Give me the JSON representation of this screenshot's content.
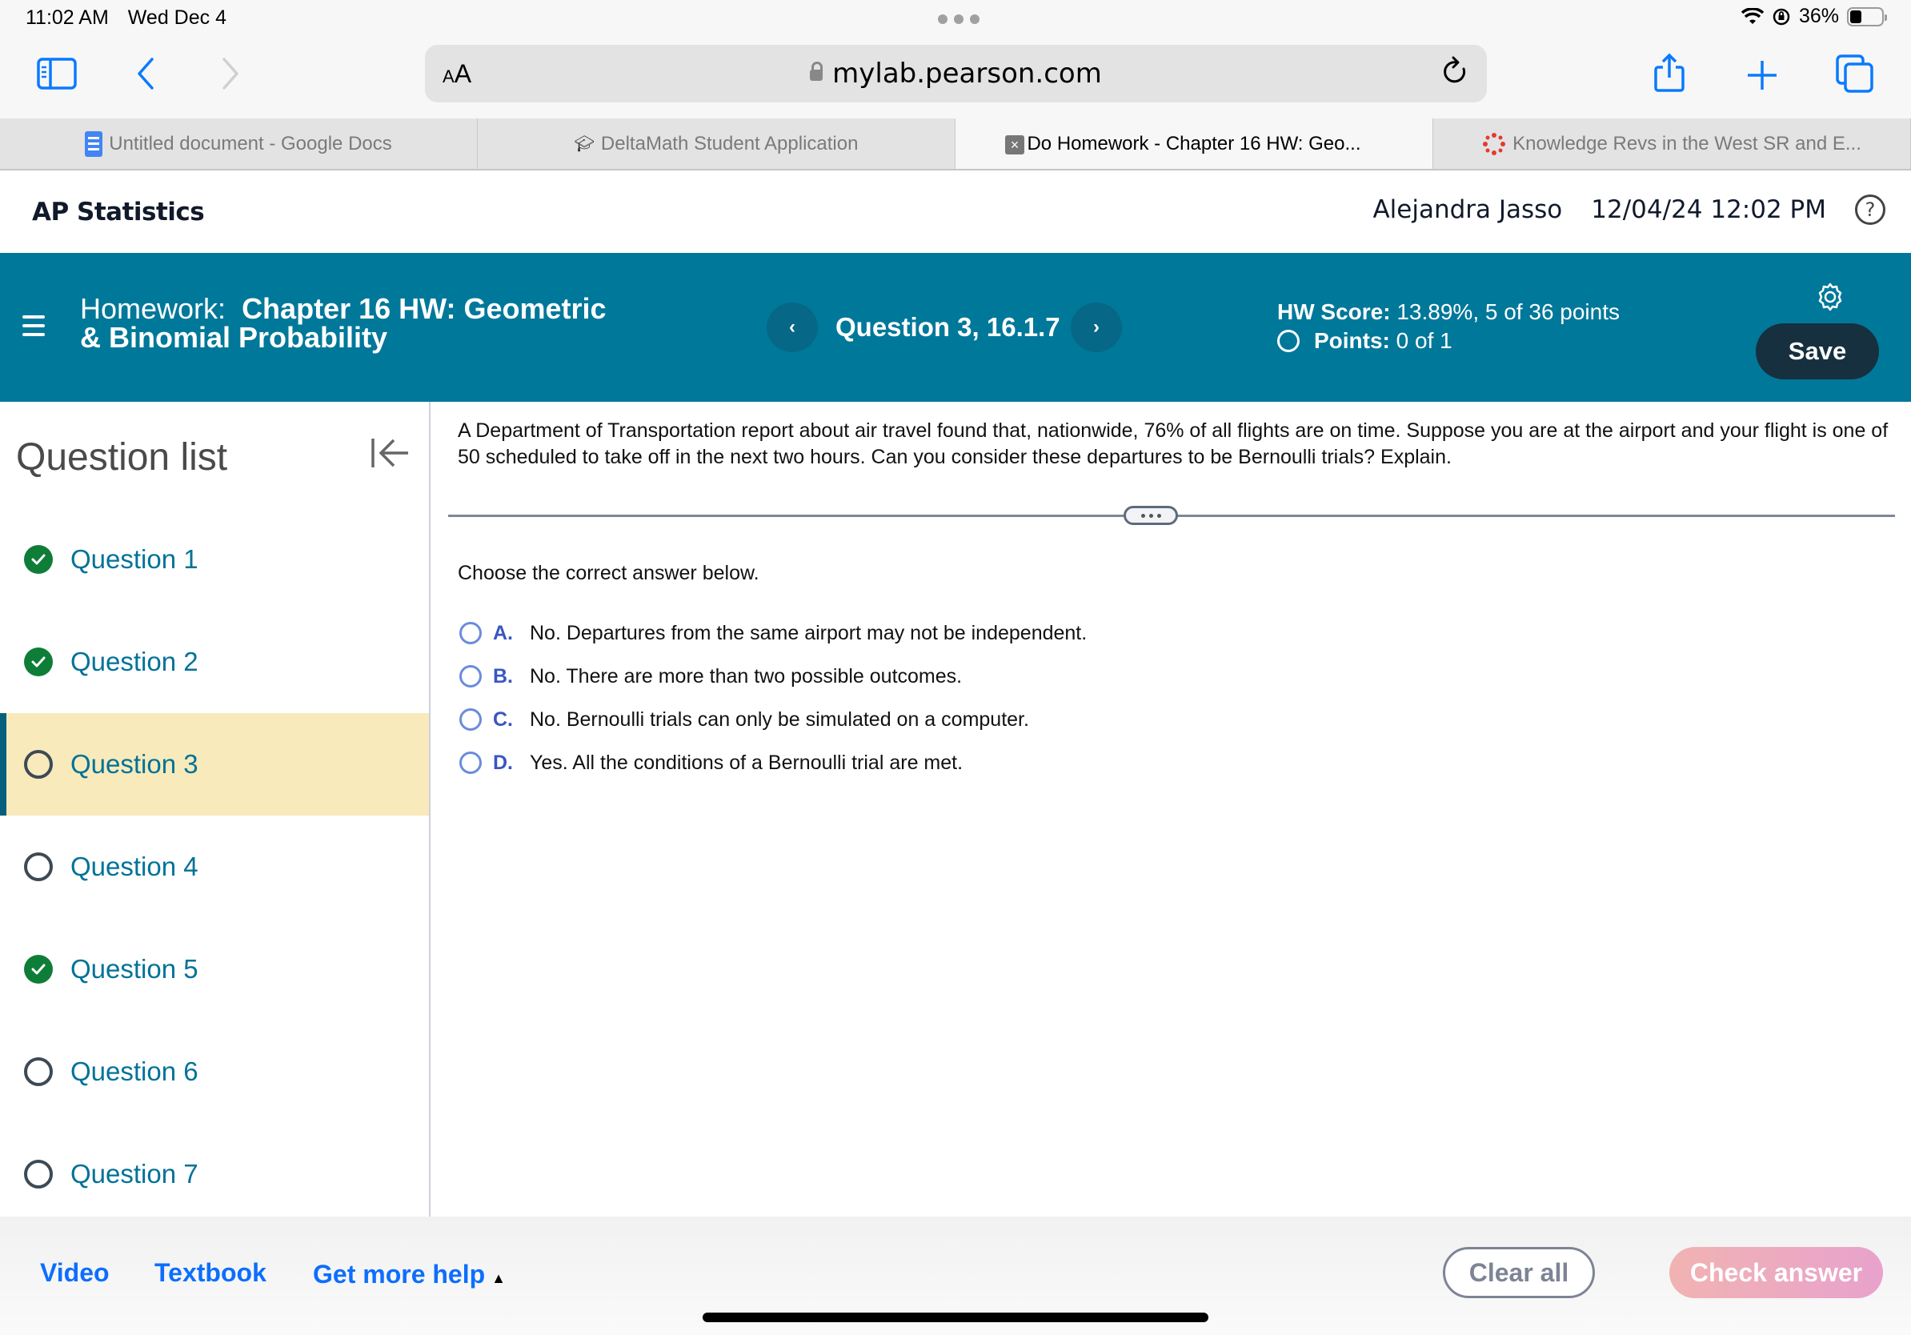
{
  "status_bar": {
    "time": "11:02 AM",
    "date": "Wed Dec 4",
    "battery_text": "36%",
    "battery_level_percent": 36
  },
  "browser": {
    "aa_label_small": "A",
    "aa_label_large": "A",
    "url": "mylab.pearson.com",
    "icons": [
      "sidebar-icon",
      "back-icon",
      "forward-icon",
      "reload-icon",
      "share-icon",
      "new-tab-icon",
      "tabs-overview-icon"
    ]
  },
  "tabs": [
    {
      "label": "Untitled document - Google Docs",
      "icon": "google-docs-icon",
      "active": false
    },
    {
      "label": "DeltaMath Student Application",
      "icon": "graduation-cap-icon",
      "active": false
    },
    {
      "label": "Do Homework - Chapter 16 HW: Geo...",
      "icon": "close-icon",
      "active": true
    },
    {
      "label": "Knowledge Revs in the West SR and E...",
      "icon": "canvas-icon",
      "active": false
    }
  ],
  "course": {
    "title": "AP Statistics",
    "user": "Alejandra Jasso",
    "datetime": "12/04/24 12:02 PM",
    "help_glyph": "?"
  },
  "homework_header": {
    "prefix": "Homework:",
    "title_line1": "Chapter 16 HW: Geometric",
    "title_line2": "& Binomial Probability",
    "prev_glyph": "‹",
    "next_glyph": "›",
    "question_label": "Question 3, 16.1.7",
    "hw_score_label": "HW Score:",
    "hw_score_value": "13.89%, 5 of 36 points",
    "points_label": "Points:",
    "points_value": "0 of 1",
    "save_label": "Save"
  },
  "question_list": {
    "title": "Question list",
    "items": [
      {
        "label": "Question 1",
        "status": "correct",
        "current": false
      },
      {
        "label": "Question 2",
        "status": "correct",
        "current": false
      },
      {
        "label": "Question 3",
        "status": "unanswered",
        "current": true
      },
      {
        "label": "Question 4",
        "status": "unanswered",
        "current": false
      },
      {
        "label": "Question 5",
        "status": "correct",
        "current": false
      },
      {
        "label": "Question 6",
        "status": "unanswered",
        "current": false
      },
      {
        "label": "Question 7",
        "status": "unanswered",
        "current": false
      }
    ]
  },
  "question": {
    "prompt": "A Department of Transportation report about air travel found that, nationwide, 76% of all flights are on time.  Suppose you are at the airport and your flight is one of 50 scheduled to take off in the next two hours.  Can you consider these departures to be Bernoulli trials?  Explain.",
    "instruction": "Choose the correct answer below.",
    "options": [
      {
        "letter": "A.",
        "text": "No.  Departures from the same airport may not be independent."
      },
      {
        "letter": "B.",
        "text": "No.  There are more than two possible outcomes."
      },
      {
        "letter": "C.",
        "text": "No.  Bernoulli trials can only be simulated on a computer."
      },
      {
        "letter": "D.",
        "text": "Yes.  All the conditions of a Bernoulli trial are met."
      }
    ]
  },
  "footer": {
    "video_label": "Video",
    "textbook_label": "Textbook",
    "more_help_label": "Get more help",
    "more_help_glyph": "▲",
    "clear_label": "Clear all",
    "check_label": "Check answer"
  },
  "colors": {
    "header_blue": "#00789a",
    "save_dark": "#16303f",
    "current_highlight": "#f8eabb",
    "link_teal": "#007298",
    "correct_green": "#0e7d38",
    "ios_blue": "#0a7aff"
  }
}
